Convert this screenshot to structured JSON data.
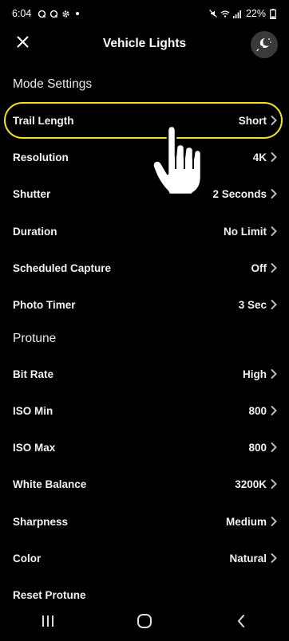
{
  "status": {
    "time": "6:04",
    "battery": "22%"
  },
  "header": {
    "title": "Vehicle Lights"
  },
  "sections": {
    "mode": "Mode Settings",
    "protune": "Protune"
  },
  "mode_settings": [
    {
      "label": "Trail Length",
      "value": "Short"
    },
    {
      "label": "Resolution",
      "value": "4K"
    },
    {
      "label": "Shutter",
      "value": "2 Seconds"
    },
    {
      "label": "Duration",
      "value": "No Limit"
    },
    {
      "label": "Scheduled Capture",
      "value": "Off"
    },
    {
      "label": "Photo Timer",
      "value": "3 Sec"
    }
  ],
  "protune": [
    {
      "label": "Bit Rate",
      "value": "High"
    },
    {
      "label": "ISO Min",
      "value": "800"
    },
    {
      "label": "ISO Max",
      "value": "800"
    },
    {
      "label": "White Balance",
      "value": "3200K"
    },
    {
      "label": "Sharpness",
      "value": "Medium"
    },
    {
      "label": "Color",
      "value": "Natural"
    },
    {
      "label": "Reset Protune",
      "value": ""
    }
  ],
  "colors": {
    "highlight": "#f0e21e",
    "background": "#000000",
    "mode_button": "#3a3a3a"
  },
  "icons": [
    "close-icon",
    "night-mode-icon",
    "chevron-right-icon",
    "pointing-hand-icon",
    "recent-apps-icon",
    "home-icon",
    "back-icon"
  ]
}
